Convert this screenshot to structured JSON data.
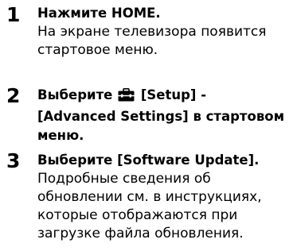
{
  "steps": [
    {
      "number": "1",
      "title": "Нажмите HOME.",
      "lines": [
        "На экране телевизора появится",
        "стартовое меню."
      ]
    },
    {
      "number": "2",
      "title_prefix": "Выберите",
      "icon": "toolbox-setup-icon",
      "title_line1_rest": "[Setup] -",
      "title_line2": "[Advanced Settings] в стартовом",
      "title_line3": "меню."
    },
    {
      "number": "3",
      "title": "Выберите [Software Update].",
      "lines": [
        "Подробные сведения об",
        "обновлении см. в инструкциях,",
        "которые отображаются при",
        "загрузке файла обновления."
      ]
    }
  ]
}
